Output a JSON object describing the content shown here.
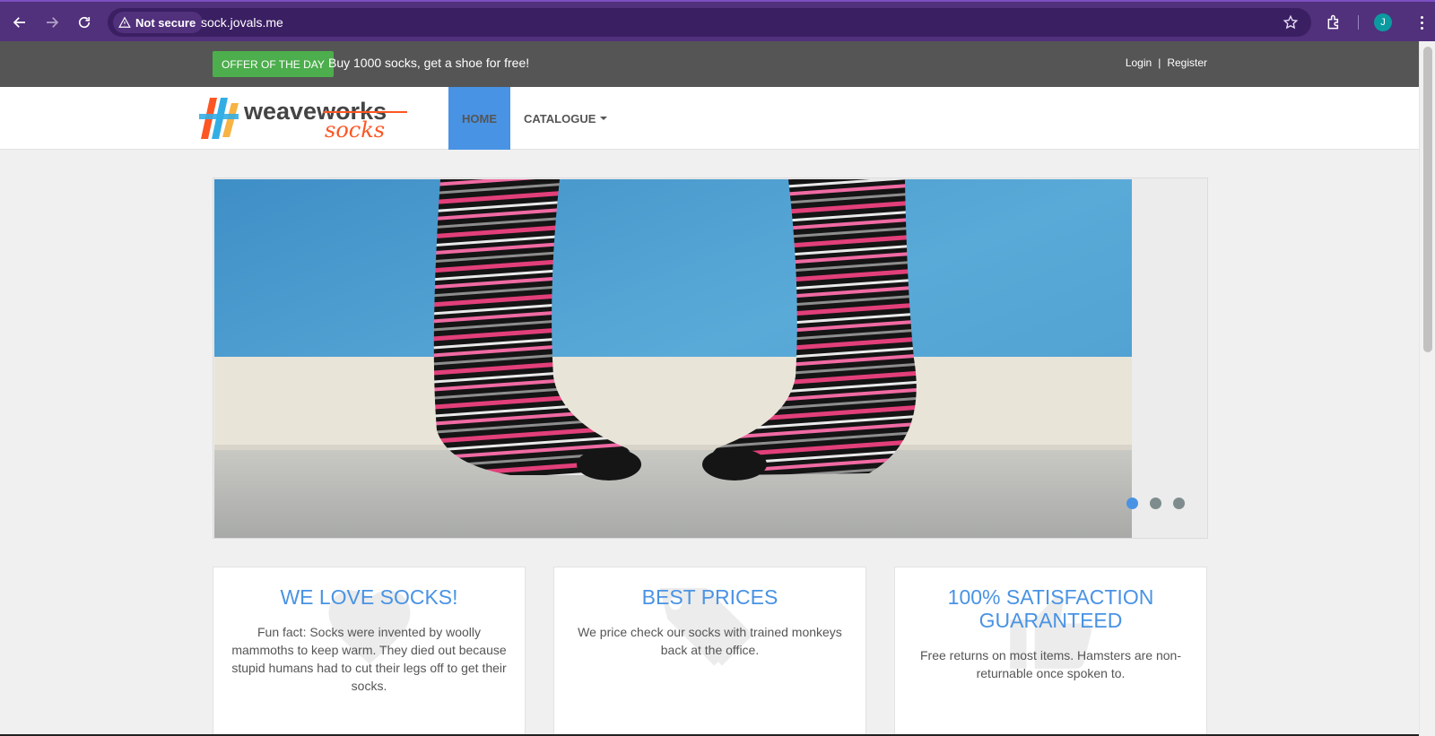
{
  "browser": {
    "security_label": "Not secure",
    "url": "sock.jovals.me",
    "profile_initial": "J",
    "icons": [
      "back-arrow-icon",
      "forward-arrow-icon",
      "reload-icon",
      "warning-triangle-icon",
      "star-icon",
      "extensions-icon",
      "more-vert-icon"
    ]
  },
  "topbar": {
    "offer_badge": "OFFER OF THE DAY",
    "offer_text": "Buy 1000 socks, get a shoe for free!",
    "login": "Login",
    "divider": "|",
    "register": "Register"
  },
  "nav": {
    "logo_text_primary": "weaveworks",
    "logo_text_secondary": "socks",
    "home": "HOME",
    "catalogue": "CATALOGUE"
  },
  "carousel": {
    "slide_count": 3,
    "active_index": 0
  },
  "features": [
    {
      "title": "WE LOVE SOCKS!",
      "text": "Fun fact: Socks were invented by woolly mammoths to keep warm. They died out because stupid humans had to cut their legs off to get their socks.",
      "icon": "heart-icon"
    },
    {
      "title": "BEST PRICES",
      "text": "We price check our socks with trained monkeys back at the office.",
      "icon": "tags-icon"
    },
    {
      "title": "100% SATISFACTION GUARANTEED",
      "text": "Free returns on most items. Hamsters are non-returnable once spoken to.",
      "icon": "thumbs-up-icon"
    }
  ],
  "colors": {
    "browser_chrome": "#51307c",
    "topbar": "#555555",
    "offer_green": "#4cae4c",
    "accent_blue": "#4993e4",
    "page_bg": "#f0f0f0"
  }
}
